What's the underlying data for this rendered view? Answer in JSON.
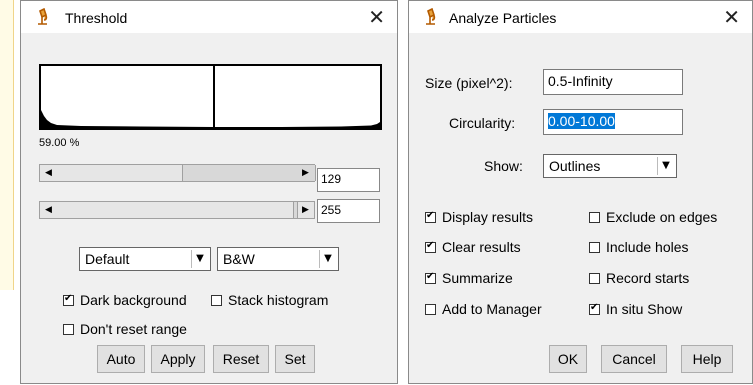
{
  "threshold": {
    "title": "Threshold",
    "percent_text": "59.00 %",
    "slider1_value": "129",
    "slider2_value": "255",
    "method_select": "Default",
    "mode_select": "B&W",
    "dark_background_label": "Dark background",
    "dark_background_checked": true,
    "stack_histogram_label": "Stack histogram",
    "stack_histogram_checked": false,
    "dont_reset_label": "Don't reset range",
    "dont_reset_checked": false,
    "buttons": {
      "auto": "Auto",
      "apply": "Apply",
      "reset": "Reset",
      "set": "Set"
    }
  },
  "analyze": {
    "title": "Analyze Particles",
    "size_label": "Size (pixel^2):",
    "size_value": "0.5-Infinity",
    "circularity_label": "Circularity:",
    "circularity_value": "0.00-10.00",
    "show_label": "Show:",
    "show_value": "Outlines",
    "options": {
      "display_results": "Display results",
      "exclude_on_edges": "Exclude on edges",
      "clear_results": "Clear results",
      "include_holes": "Include holes",
      "summarize": "Summarize",
      "record_starts": "Record starts",
      "add_to_manager": "Add to Manager",
      "in_situ_show": "In situ Show"
    },
    "buttons": {
      "ok": "OK",
      "cancel": "Cancel",
      "help": "Help"
    }
  },
  "icons": {
    "window_icon": "microscope-icon",
    "close_icon": "close-icon",
    "dropdown_icon": "chevron-down-icon"
  }
}
